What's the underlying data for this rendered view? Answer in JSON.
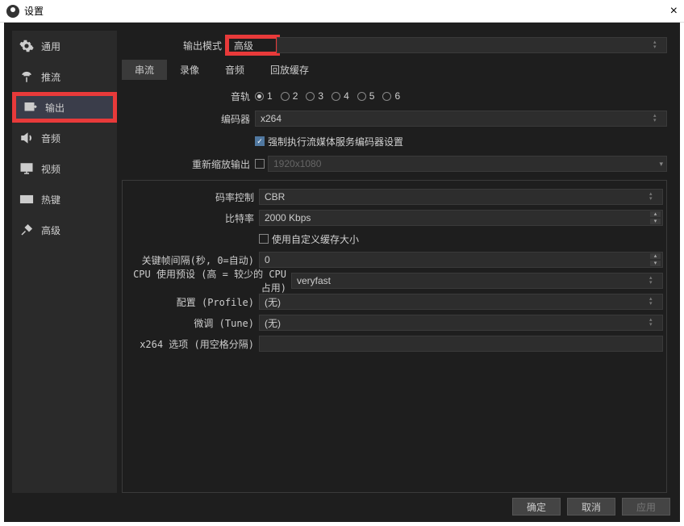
{
  "title": "设置",
  "sidebar": {
    "items": [
      {
        "label": "通用"
      },
      {
        "label": "推流"
      },
      {
        "label": "输出"
      },
      {
        "label": "音频"
      },
      {
        "label": "视频"
      },
      {
        "label": "热键"
      },
      {
        "label": "高级"
      }
    ]
  },
  "output_mode": {
    "label": "输出模式",
    "value": "高级"
  },
  "tabs": [
    {
      "label": "串流"
    },
    {
      "label": "录像"
    },
    {
      "label": "音频"
    },
    {
      "label": "回放缓存"
    }
  ],
  "tracks": {
    "label": "音轨",
    "options": [
      "1",
      "2",
      "3",
      "4",
      "5",
      "6"
    ],
    "selected": "1"
  },
  "encoder": {
    "label": "编码器",
    "value": "x264"
  },
  "enforce": {
    "label": "强制执行流媒体服务编码器设置",
    "checked": true
  },
  "rescale": {
    "label": "重新缩放输出",
    "checked": false,
    "placeholder": "1920x1080"
  },
  "rate_control": {
    "label": "码率控制",
    "value": "CBR"
  },
  "bitrate": {
    "label": "比特率",
    "value": "2000 Kbps"
  },
  "custom_buffer": {
    "label": "使用自定义缓存大小",
    "checked": false
  },
  "keyframe": {
    "label": "关键帧间隔(秒, 0=自动)",
    "value": "0"
  },
  "cpu_preset": {
    "label": "CPU 使用预设 (高 = 较少的 CPU占用)",
    "value": "veryfast"
  },
  "profile": {
    "label": "配置 (Profile)",
    "value": "(无)"
  },
  "tune": {
    "label": "微调 (Tune)",
    "value": "(无)"
  },
  "x264opts": {
    "label": "x264 选项 (用空格分隔)",
    "value": ""
  },
  "buttons": {
    "ok": "确定",
    "cancel": "取消",
    "apply": "应用"
  }
}
